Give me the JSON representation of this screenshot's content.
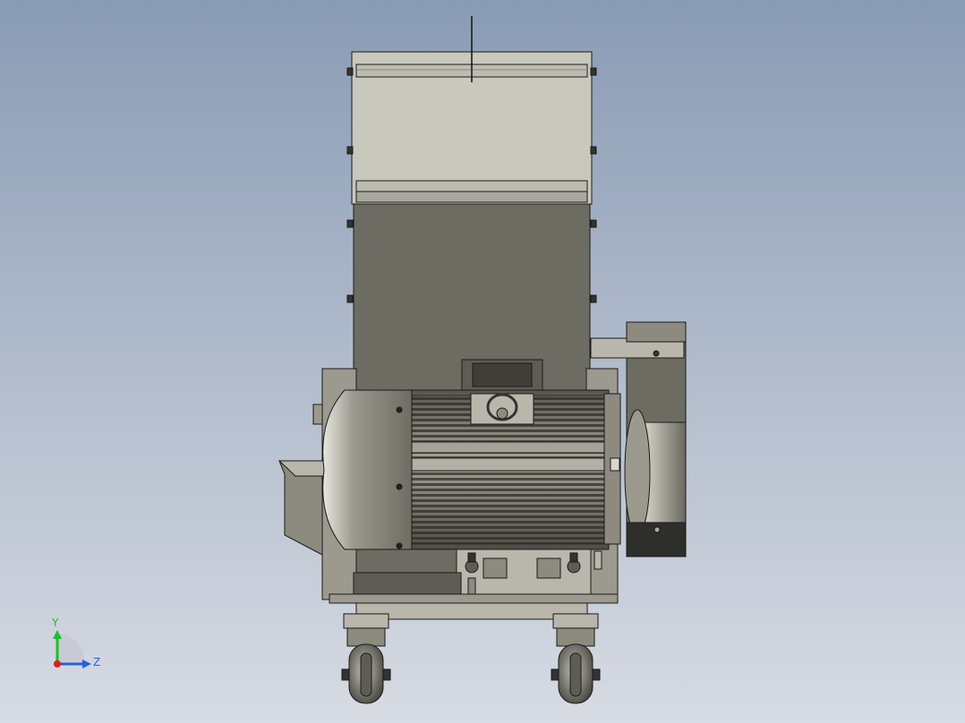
{
  "viewport": {
    "background_top": "#8a9bb4",
    "background_bottom": "#d7dbe3"
  },
  "triad": {
    "y_label": "Y",
    "z_label": "Z",
    "y_color": "#1fbf2a",
    "z_color": "#2b5fd6",
    "origin_color": "#d62020"
  },
  "model": {
    "colors": {
      "hopper_light": "#c9c8bd",
      "body_dark": "#6d6c63",
      "steel": "#9c9a8f",
      "steel_light": "#b9b7ab",
      "motor": "#7f7d72",
      "outline": "#1a1a1a"
    }
  }
}
